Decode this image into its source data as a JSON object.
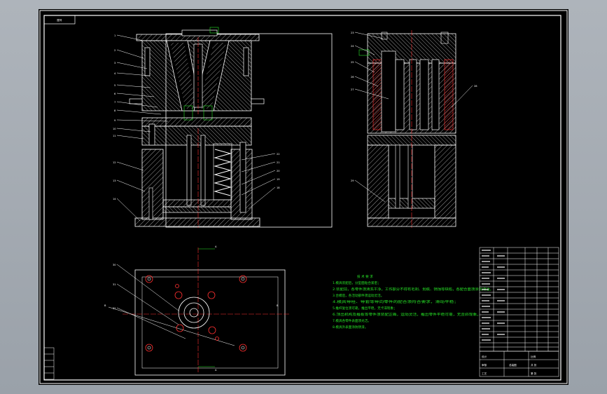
{
  "drawing": {
    "sheet_tag": "图号",
    "tech_title": "技 术 要 求",
    "tech_lines": [
      "1.模具装配后，分型面贴合紧密；",
      "2.装配前，各零件须清洗干净，工作部分不得有毛刺、划痕、锈蚀等缺陷，各配合面须涂润滑油。",
      "3.合模后，各活动部件须运动灵活。",
      "4.模具导柱、导套等导向零件的配合须符合要求，滑动平稳；",
      "5.推杆复位须可靠，推出平稳，无卡滞现象；",
      "6.顶出机构及推板等零件须装配正确，运动灵活，推出零件平稳可靠，无歪斜现象。",
      "7.模具各零件表面须光洁。",
      "8.模具外表面涂防锈漆。"
    ],
    "title_block": {
      "name": "总装图",
      "cells": [
        "设计",
        "审核",
        "工艺",
        "比例",
        "共 张",
        "第 张"
      ]
    },
    "left_callouts": [
      "1",
      "2",
      "3",
      "4",
      "5",
      "6",
      "7",
      "8",
      "9",
      "10",
      "11",
      "12",
      "13",
      "14",
      "15",
      "16",
      "17"
    ],
    "right_callouts": [
      "22",
      "21",
      "20",
      "19",
      "18"
    ],
    "side_callouts": [
      "23",
      "24",
      "25",
      "26",
      "27",
      "28",
      "29"
    ],
    "plan_callouts": [
      "30",
      "31",
      "32"
    ],
    "section_marks": [
      "A",
      "A",
      "B",
      "B"
    ]
  },
  "colors": {
    "line": "#ffffff",
    "red": "#ff2a2a",
    "green": "#27e627",
    "hatch": "#ffffff",
    "frame": "#ffffff"
  }
}
